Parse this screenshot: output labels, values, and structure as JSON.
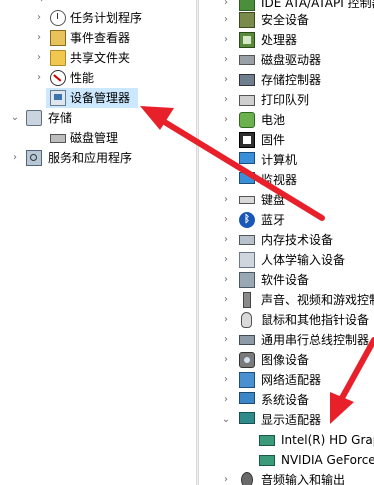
{
  "left_tree": {
    "items": [
      {
        "label": "任务计划程序",
        "icon": "task-scheduler-icon"
      },
      {
        "label": "事件查看器",
        "icon": "event-viewer-icon"
      },
      {
        "label": "共享文件夹",
        "icon": "shared-folder-icon"
      },
      {
        "label": "性能",
        "icon": "performance-icon"
      },
      {
        "label": "设备管理器",
        "icon": "device-manager-icon",
        "selected": true
      },
      {
        "label": "存储",
        "icon": "storage-icon",
        "expanded": true
      },
      {
        "label": "磁盘管理",
        "icon": "disk-management-icon"
      },
      {
        "label": "服务和应用程序",
        "icon": "services-apps-icon"
      }
    ]
  },
  "right_tree": {
    "items": [
      {
        "label": "IDE ATA/ATAPI 控制器",
        "icon": "ide-controller-icon"
      },
      {
        "label": "安全设备",
        "icon": "security-device-icon"
      },
      {
        "label": "处理器",
        "icon": "processor-icon"
      },
      {
        "label": "磁盘驱动器",
        "icon": "disk-drive-icon"
      },
      {
        "label": "存储控制器",
        "icon": "storage-controller-icon"
      },
      {
        "label": "打印队列",
        "icon": "print-queue-icon"
      },
      {
        "label": "电池",
        "icon": "battery-icon"
      },
      {
        "label": "固件",
        "icon": "firmware-icon"
      },
      {
        "label": "计算机",
        "icon": "computer-icon"
      },
      {
        "label": "监视器",
        "icon": "monitor-icon"
      },
      {
        "label": "键盘",
        "icon": "keyboard-icon"
      },
      {
        "label": "蓝牙",
        "icon": "bluetooth-icon"
      },
      {
        "label": "内存技术设备",
        "icon": "memory-tech-icon"
      },
      {
        "label": "人体学输入设备",
        "icon": "hid-icon"
      },
      {
        "label": "软件设备",
        "icon": "software-device-icon"
      },
      {
        "label": "声音、视频和游戏控制器",
        "icon": "sound-video-icon"
      },
      {
        "label": "鼠标和其他指针设备",
        "icon": "mouse-icon"
      },
      {
        "label": "通用串行总线控制器",
        "icon": "usb-controller-icon"
      },
      {
        "label": "图像设备",
        "icon": "imaging-device-icon"
      },
      {
        "label": "网络适配器",
        "icon": "network-adapter-icon"
      },
      {
        "label": "系统设备",
        "icon": "system-device-icon"
      },
      {
        "label": "显示适配器",
        "icon": "display-adapter-icon",
        "expanded": true
      },
      {
        "label": "Intel(R) HD Graphics",
        "icon": "gpu-icon"
      },
      {
        "label": "NVIDIA GeForce",
        "icon": "gpu-icon"
      },
      {
        "label": "音频输入和输出",
        "icon": "audio-io-icon"
      }
    ]
  },
  "colors": {
    "selection": "#cce8ff",
    "annotation_arrow": "#e8202a"
  }
}
